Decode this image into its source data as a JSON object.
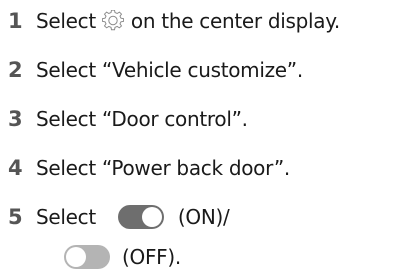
{
  "steps": [
    {
      "number": "1",
      "text_before": "Select",
      "icon": "gear-icon",
      "text_after": "on the center display."
    },
    {
      "number": "2",
      "text": "Select “Vehicle customize”."
    },
    {
      "number": "3",
      "text": "Select “Door control”."
    },
    {
      "number": "4",
      "text": "Select “Power back door”."
    },
    {
      "number": "5",
      "text_before": "Select",
      "toggle_on_label": "(ON)/",
      "toggle_off_label": "(OFF)."
    }
  ],
  "colors": {
    "step_number": "#555555",
    "toggle_on": "#6e6e6e",
    "toggle_off": "#b4b4b4"
  }
}
